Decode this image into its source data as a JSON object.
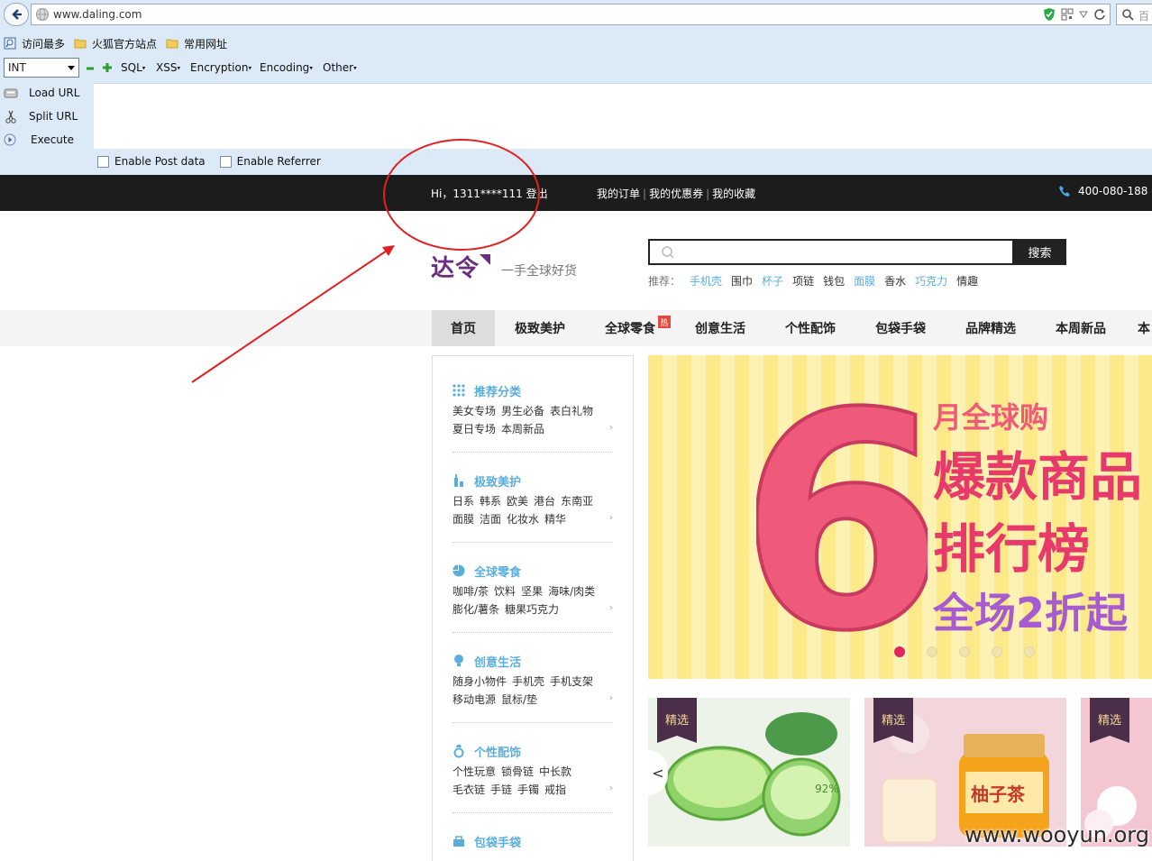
{
  "browser": {
    "url": "www.daling.com",
    "search_placeholder": "百",
    "bookmarks": [
      "访问最多",
      "火狐官方站点",
      "常用网址"
    ]
  },
  "hackbar": {
    "select_value": "INT",
    "menus": [
      "SQL",
      "XSS",
      "Encryption",
      "Encoding",
      "Other"
    ],
    "actions": [
      "Load URL",
      "Split URL",
      "Execute"
    ],
    "post_data_label": "Enable Post data",
    "referrer_label": "Enable Referrer"
  },
  "site": {
    "greeting": "Hi，1311****111 登出",
    "top_links": [
      "我的订单",
      "我的优惠券",
      "我的收藏"
    ],
    "phone": "400-080-188",
    "logo_text": "达令",
    "logo_tagline": "一手全球好货",
    "search_button": "搜索",
    "hot_label": "推荐：",
    "hot_words": [
      {
        "text": "手机壳",
        "highlight": true
      },
      {
        "text": "围巾",
        "highlight": false
      },
      {
        "text": "杯子",
        "highlight": true
      },
      {
        "text": "项链",
        "highlight": false
      },
      {
        "text": "钱包",
        "highlight": false
      },
      {
        "text": "面膜",
        "highlight": true
      },
      {
        "text": "香水",
        "highlight": false
      },
      {
        "text": "巧克力",
        "highlight": true
      },
      {
        "text": "情趣",
        "highlight": false
      }
    ],
    "nav": [
      "首页",
      "极致美护",
      "全球零食",
      "创意生活",
      "个性配饰",
      "包袋手袋",
      "品牌精选",
      "本周新品",
      "本"
    ],
    "nav_hot_badge": "热",
    "categories": [
      {
        "title": "推荐分类",
        "icon": "grid-icon",
        "line1": [
          "美女专场",
          "男生必备",
          "表白礼物"
        ],
        "line2": [
          "夏日专场",
          "本周新品"
        ]
      },
      {
        "title": "极致美护",
        "icon": "bottle-icon",
        "line1": [
          "日系",
          "韩系",
          "欧美",
          "港台",
          "东南亚"
        ],
        "line2": [
          "面膜",
          "洁面",
          "化妆水",
          "精华"
        ]
      },
      {
        "title": "全球零食",
        "icon": "pie-icon",
        "line1": [
          "咖啡/茶",
          "饮料",
          "坚果",
          "海味/肉类"
        ],
        "line2": [
          "膨化/薯条",
          "糖果巧克力"
        ]
      },
      {
        "title": "创意生活",
        "icon": "bulb-icon",
        "line1": [
          "随身小物件",
          "手机壳",
          "手机支架"
        ],
        "line2": [
          "移动电源",
          "鼠标/垫"
        ]
      },
      {
        "title": "个性配饰",
        "icon": "ring-icon",
        "line1": [
          "个性玩意",
          "锁骨链",
          "中长款"
        ],
        "line2": [
          "毛衣链",
          "手链",
          "手镯",
          "戒指"
        ]
      },
      {
        "title": "包袋手袋",
        "icon": "bag-icon",
        "line1": [],
        "line2": []
      }
    ],
    "banner": {
      "big_number": "6",
      "line1": "月全球购",
      "line2": "爆款商品",
      "line3": "排行榜",
      "line4": "全场2折起",
      "slides": 5,
      "active_slide": 1
    },
    "cards": [
      {
        "tag": "精选",
        "label": "92%"
      },
      {
        "tag": "精选",
        "label": "柚子茶"
      },
      {
        "tag": "精选",
        "label": ""
      }
    ],
    "prev_arrow": "<"
  },
  "watermark": "www.wooyun.org",
  "colors": {
    "chrome_bg": "#dce9f6",
    "topbar_bg": "#1c1c1c",
    "accent_blue": "#5aaedc",
    "logo_purple": "#6b2f7f",
    "annotation_red": "#e02020"
  }
}
